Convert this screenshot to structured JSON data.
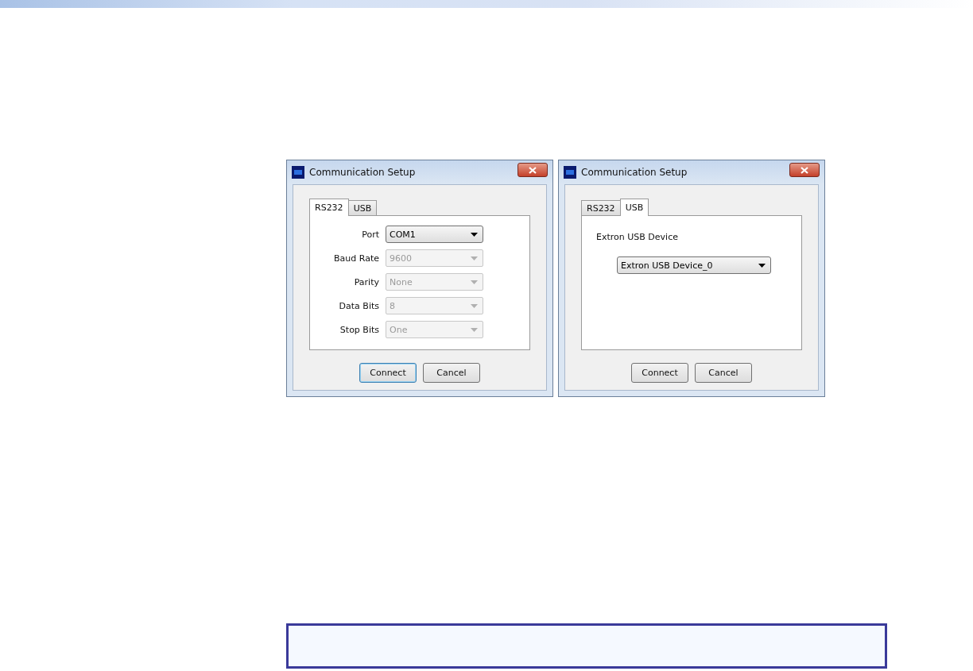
{
  "dialogs": [
    {
      "title": "Communication Setup",
      "tabs": [
        {
          "label": "RS232",
          "selected": true
        },
        {
          "label": "USB",
          "selected": false
        }
      ],
      "panel": {
        "kind": "fields",
        "fields": [
          {
            "label": "Port",
            "value": "COM1",
            "disabled": false
          },
          {
            "label": "Baud Rate",
            "value": "9600",
            "disabled": true
          },
          {
            "label": "Parity",
            "value": "None",
            "disabled": true
          },
          {
            "label": "Data Bits",
            "value": "8",
            "disabled": true
          },
          {
            "label": "Stop Bits",
            "value": "One",
            "disabled": true
          }
        ]
      },
      "buttons": [
        {
          "label": "Connect",
          "focused": true
        },
        {
          "label": "Cancel",
          "focused": false
        }
      ]
    },
    {
      "title": "Communication Setup",
      "tabs": [
        {
          "label": "RS232",
          "selected": false
        },
        {
          "label": "USB",
          "selected": true
        }
      ],
      "panel": {
        "kind": "device",
        "label": "Extron USB Device",
        "value": "Extron USB Device_0"
      },
      "buttons": [
        {
          "label": "Connect",
          "focused": false
        },
        {
          "label": "Cancel",
          "focused": false
        }
      ]
    }
  ]
}
